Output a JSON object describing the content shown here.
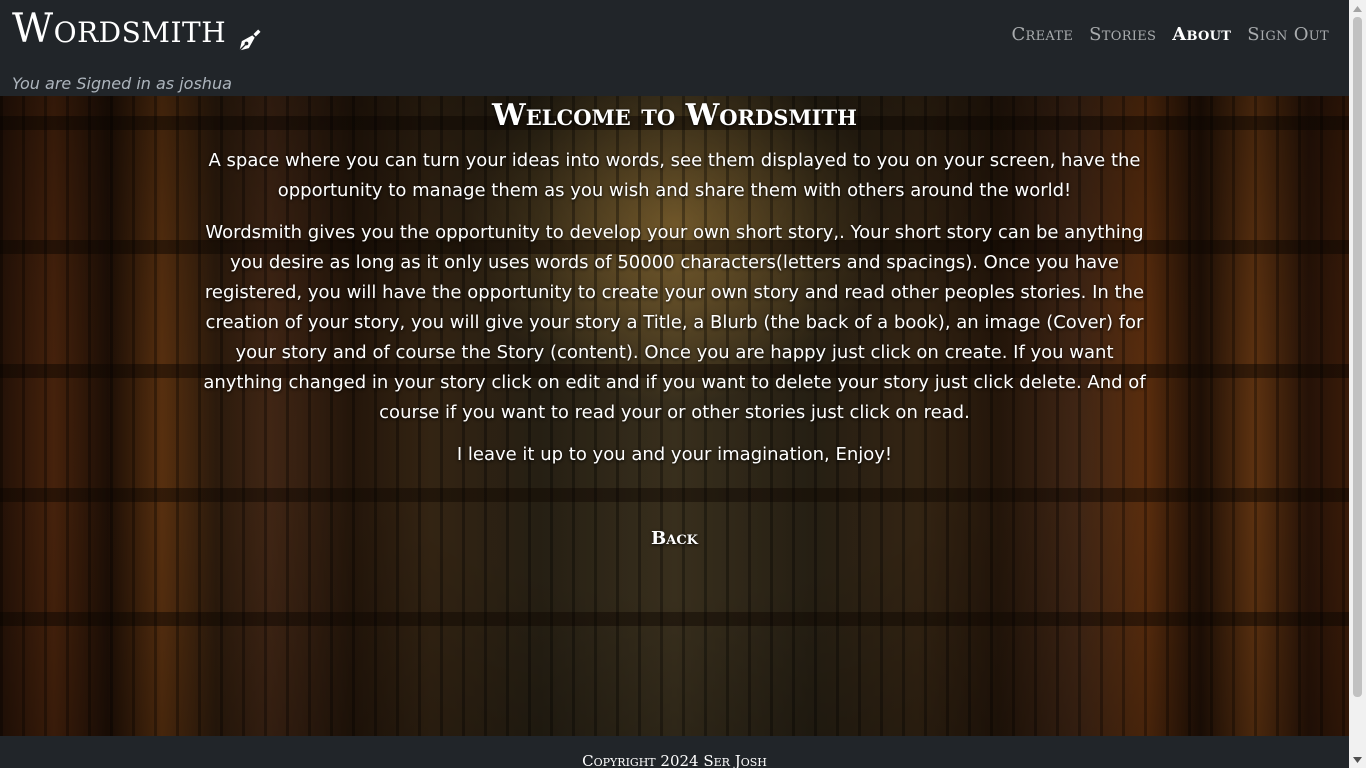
{
  "header": {
    "brand": "Wordsmith",
    "signed_in": "You are Signed in as joshua",
    "nav": [
      {
        "label": "Create"
      },
      {
        "label": "Stories"
      },
      {
        "label": "About",
        "active": true
      },
      {
        "label": "Sign Out"
      }
    ]
  },
  "main": {
    "title": "Welcome to Wordsmith",
    "intro": "A space where you can turn your ideas into words, see them displayed to you on your screen, have the opportunity to manage them as you wish and share them with others around the world!",
    "details": "Wordsmith gives you the opportunity to develop your own short story,. Your short story can be anything you desire as long as it only uses words of 50000 characters(letters and spacings). Once you have registered, you will have the opportunity to create your own story and read other peoples stories. In the creation of your story, you will give your story a Title, a Blurb (the back of a book), an image (Cover) for your story and of course the Story (content). Once you are happy just click on create. If you want anything changed in your story click on edit and if you want to delete your story just click delete. And of course if you want to read your or other stories just click on read.",
    "closing": "I leave it up to you and your imagination, Enjoy!",
    "back_label": "Back"
  },
  "footer": {
    "copyright": "Copyright 2024 Ser Josh"
  },
  "icons": {
    "brand": "pen-nib-icon"
  },
  "colors": {
    "navbar_bg": "#212529",
    "nav_inactive": "#a9acae",
    "nav_active": "#ffffff",
    "signed_in_text": "#adb5bd"
  }
}
